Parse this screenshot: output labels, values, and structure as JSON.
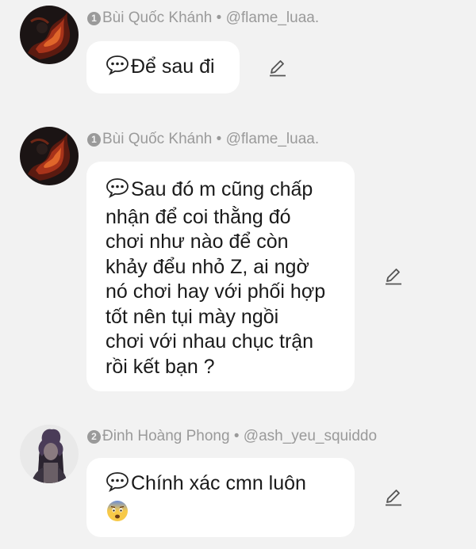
{
  "messages": [
    {
      "rank": "1",
      "author": "Bùi Quốc Khánh",
      "separator": "•",
      "handle": "@flame_luaa.",
      "text": "Để sau đi",
      "avatar_icon": "dark-fire-avatar",
      "edit_icon": "pencil-icon"
    },
    {
      "rank": "1",
      "author": "Bùi Quốc Khánh",
      "separator": "•",
      "handle": "@flame_luaa.",
      "lines": [
        "Sau đó m cũng chấp",
        "nhận để coi thằng đó",
        "chơi như nào để còn",
        "khảy đểu nhỏ Z, ai ngờ",
        "nó chơi hay với phối hợp",
        "tốt nên tụi mày ngồi",
        "chơi với nhau chục trận",
        "rồi kết bạn ?"
      ],
      "avatar_icon": "dark-fire-avatar",
      "edit_icon": "pencil-icon"
    },
    {
      "rank": "2",
      "author": "Đinh Hoàng Phong",
      "separator": "•",
      "handle": "@ash_yeu_squiddo",
      "text": "Chính xác cmn luôn",
      "emoji": "fearful-face-emoji",
      "avatar_icon": "dark-anime-avatar",
      "edit_icon": "pencil-icon"
    }
  ],
  "colors": {
    "background": "#f2f2f2",
    "bubble": "#ffffff",
    "meta_text": "#9a9a9a",
    "body_text": "#1a1a1a"
  }
}
